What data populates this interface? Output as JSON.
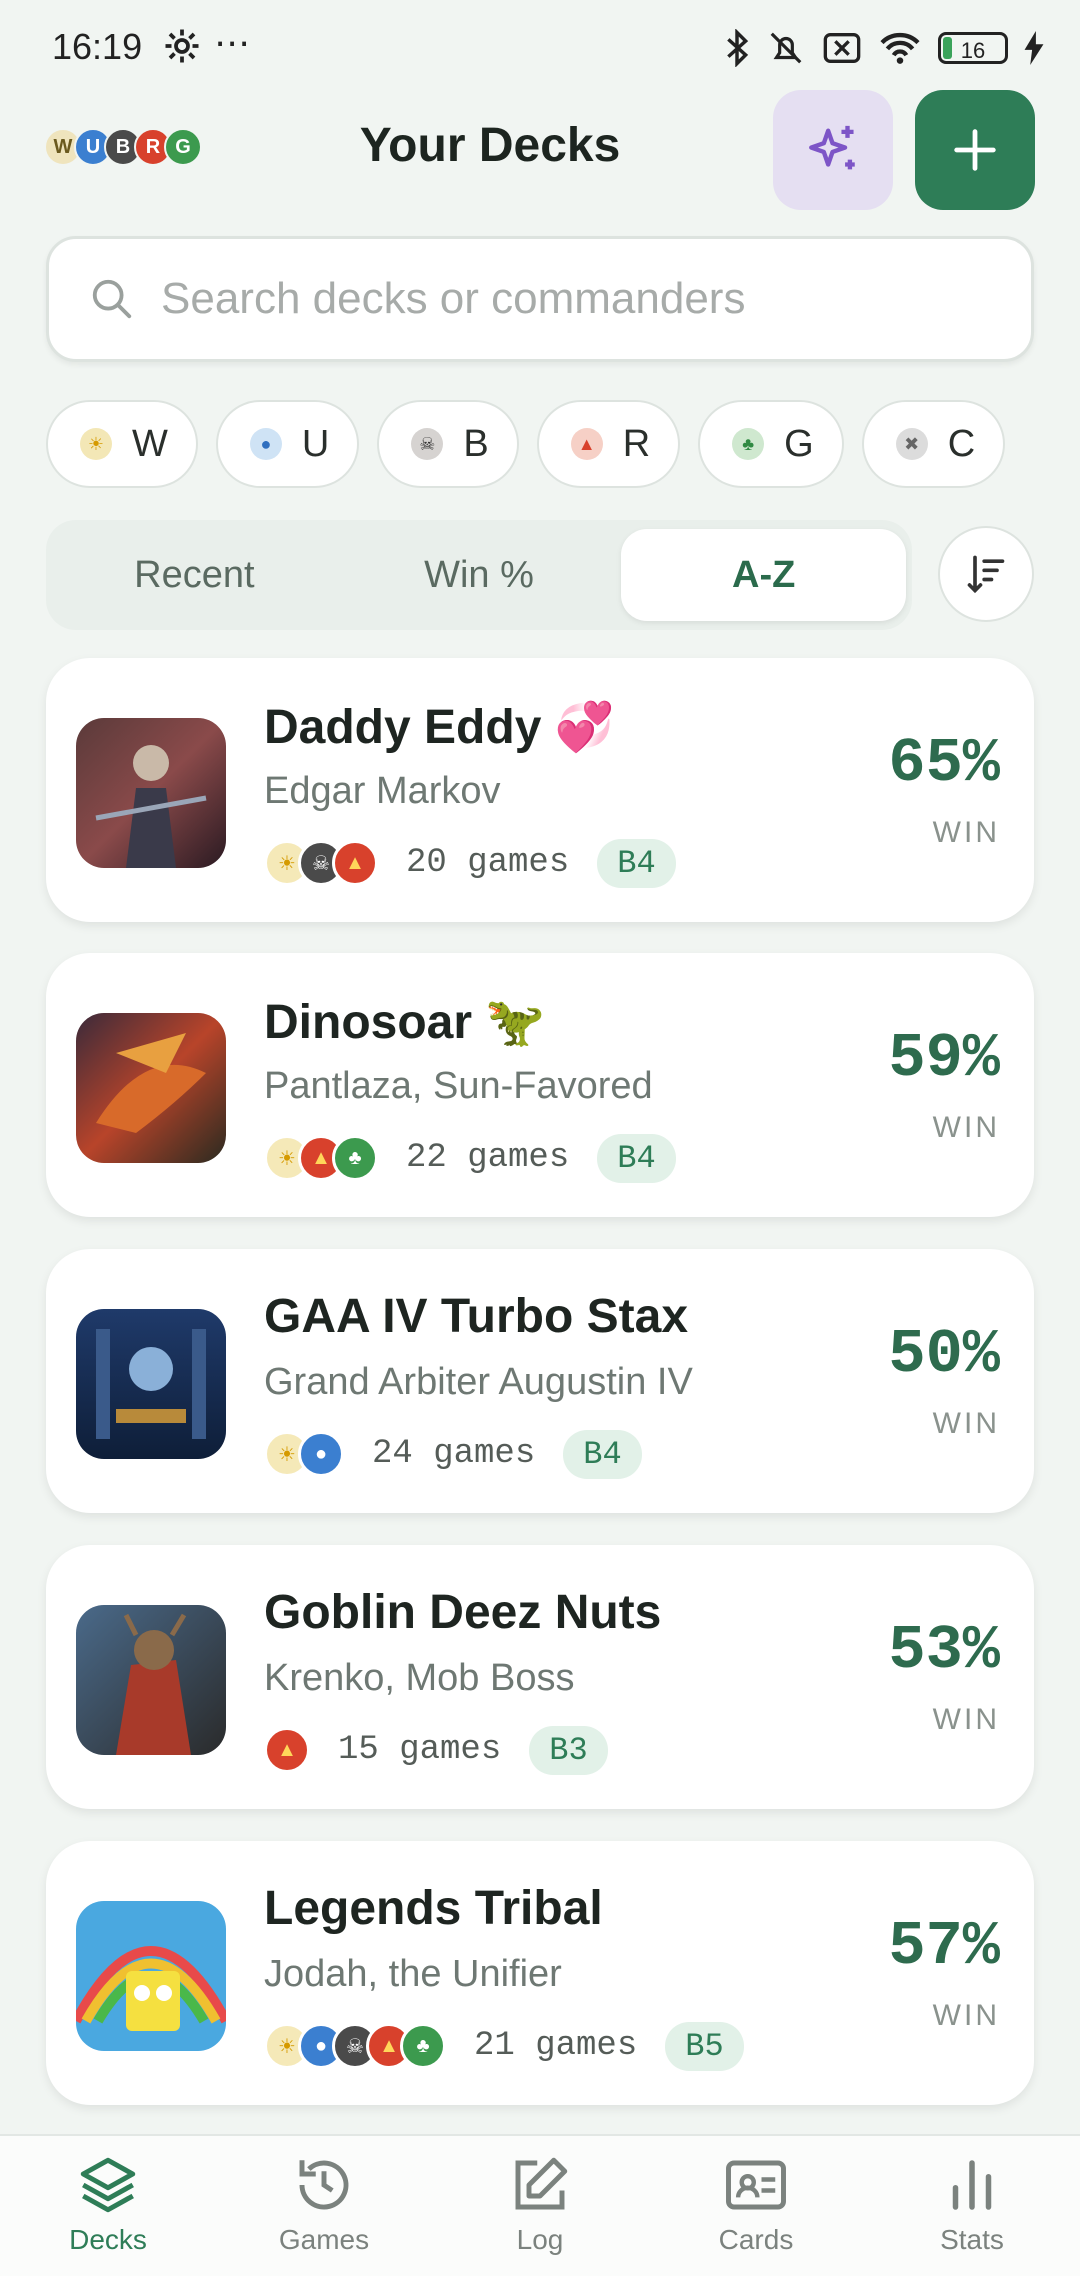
{
  "status_bar": {
    "time": "16:19",
    "dots": "⋯",
    "battery": "16"
  },
  "header": {
    "logo_letters": [
      "W",
      "U",
      "B",
      "R",
      "G"
    ],
    "title": "Your Decks"
  },
  "search": {
    "placeholder": "Search decks or commanders",
    "value": ""
  },
  "color_filters": [
    {
      "label": "W",
      "glyph": "☀",
      "color": "#f3e7b6"
    },
    {
      "label": "U",
      "glyph": "●",
      "color": "#cfe3f5"
    },
    {
      "label": "B",
      "glyph": "☠",
      "color": "#d6d3d1"
    },
    {
      "label": "R",
      "glyph": "▲",
      "color": "#f6d0c6"
    },
    {
      "label": "G",
      "glyph": "♣",
      "color": "#cfe8cf"
    },
    {
      "label": "C",
      "glyph": "✖",
      "color": "#dcdcdc"
    }
  ],
  "sort_tabs": [
    {
      "label": "Recent",
      "active": false
    },
    {
      "label": "Win %",
      "active": false
    },
    {
      "label": "A-Z",
      "active": true
    }
  ],
  "decks": [
    {
      "name": "Daddy Eddy 💞",
      "commander": "Edgar Markov",
      "colors": [
        "W",
        "B",
        "R"
      ],
      "games": "20 games",
      "bracket": "B4",
      "win": "65%",
      "win_label": "WIN"
    },
    {
      "name": "Dinosoar 🦖",
      "commander": "Pantlaza, Sun-Favored",
      "colors": [
        "W",
        "R",
        "G"
      ],
      "games": "22 games",
      "bracket": "B4",
      "win": "59%",
      "win_label": "WIN"
    },
    {
      "name": "GAA IV Turbo Stax",
      "commander": "Grand Arbiter Augustin IV",
      "colors": [
        "W",
        "U"
      ],
      "games": "24 games",
      "bracket": "B4",
      "win": "50%",
      "win_label": "WIN"
    },
    {
      "name": "Goblin Deez Nuts",
      "commander": "Krenko, Mob Boss",
      "colors": [
        "R"
      ],
      "games": "15 games",
      "bracket": "B3",
      "win": "53%",
      "win_label": "WIN"
    },
    {
      "name": "Legends Tribal",
      "commander": "Jodah, the Unifier",
      "colors": [
        "W",
        "U",
        "B",
        "R",
        "G"
      ],
      "games": "21 games",
      "bracket": "B5",
      "win": "57%",
      "win_label": "WIN"
    }
  ],
  "mana_colors": {
    "W": {
      "bg": "#f5e9b8",
      "fg": "#d59a00",
      "glyph": "☀"
    },
    "U": {
      "bg": "#3b7fd0",
      "fg": "#ffffff",
      "glyph": "●"
    },
    "B": {
      "bg": "#4a4a4a",
      "fg": "#ffffff",
      "glyph": "☠"
    },
    "R": {
      "bg": "#d8412c",
      "fg": "#ffd65a",
      "glyph": "▲"
    },
    "G": {
      "bg": "#3c9a4e",
      "fg": "#ffffff",
      "glyph": "♣"
    }
  },
  "bottom_nav": [
    {
      "label": "Decks",
      "icon": "layers-icon",
      "active": true
    },
    {
      "label": "Games",
      "icon": "history-icon",
      "active": false
    },
    {
      "label": "Log",
      "icon": "edit-icon",
      "active": false
    },
    {
      "label": "Cards",
      "icon": "card-id-icon",
      "active": false
    },
    {
      "label": "Stats",
      "icon": "bar-chart-icon",
      "active": false
    }
  ],
  "accent_color": "#2e7d57"
}
